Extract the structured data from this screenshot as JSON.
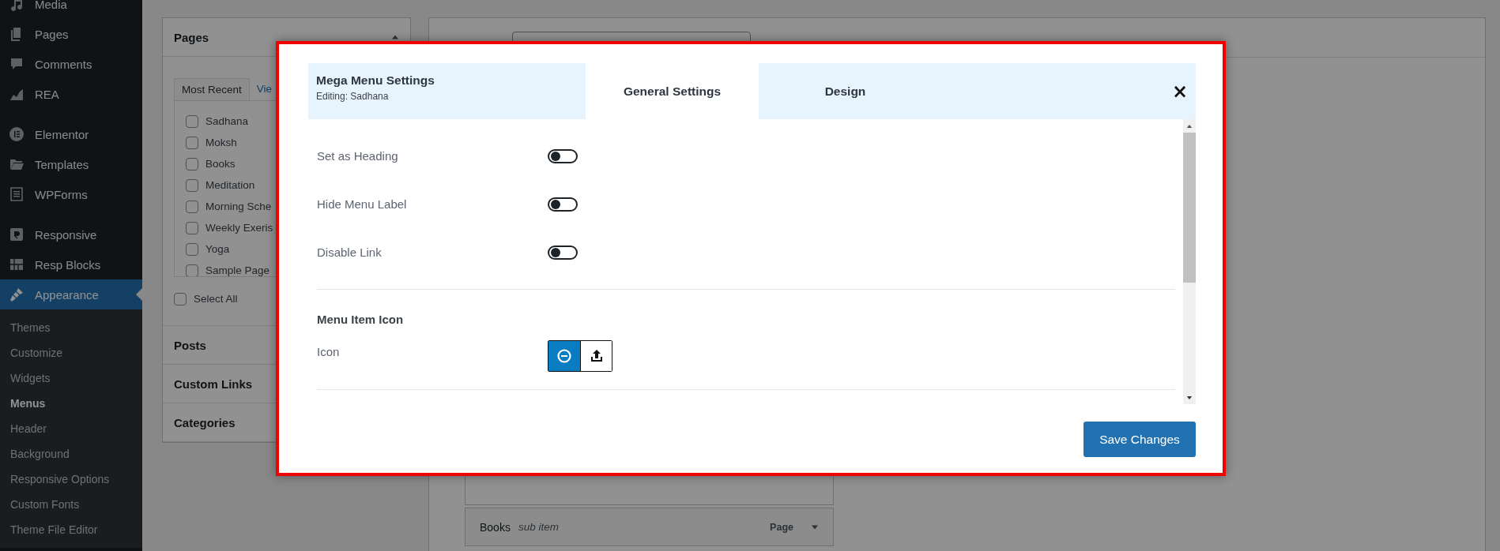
{
  "sidebar": {
    "menu": [
      [
        {
          "label": "Media",
          "current": false
        },
        {
          "label": "Pages",
          "current": false
        },
        {
          "label": "Comments",
          "current": false
        },
        {
          "label": "REA",
          "current": false
        }
      ],
      [
        {
          "label": "Elementor",
          "current": false
        },
        {
          "label": "Templates",
          "current": false
        },
        {
          "label": "WPForms",
          "current": false
        }
      ],
      [
        {
          "label": "Responsive",
          "current": false
        },
        {
          "label": "Resp Blocks",
          "current": false
        },
        {
          "label": "Appearance",
          "current": true
        }
      ]
    ],
    "submenu": [
      {
        "label": "Themes",
        "selected": false
      },
      {
        "label": "Customize",
        "selected": false
      },
      {
        "label": "Widgets",
        "selected": false
      },
      {
        "label": "Menus",
        "selected": true
      },
      {
        "label": "Header",
        "selected": false
      },
      {
        "label": "Background",
        "selected": false
      },
      {
        "label": "Responsive Options",
        "selected": false
      },
      {
        "label": "Custom Fonts",
        "selected": false
      },
      {
        "label": "Theme File Editor",
        "selected": false
      }
    ]
  },
  "add_items": {
    "pages": {
      "title": "Pages",
      "expanded": true,
      "tabs": [
        {
          "label": "Most Recent",
          "selected": true
        },
        {
          "label": "Vie",
          "selected": false
        }
      ],
      "items": [
        {
          "label": "Sadhana",
          "checked": false
        },
        {
          "label": "Moksh",
          "checked": false
        },
        {
          "label": "Books",
          "checked": false
        },
        {
          "label": "Meditation",
          "checked": false
        },
        {
          "label": "Morning Sche",
          "checked": false
        },
        {
          "label": "Weekly Exeris",
          "checked": false
        },
        {
          "label": "Yoga",
          "checked": false
        },
        {
          "label": "Sample Page",
          "checked": false
        }
      ],
      "select_all": {
        "label": "Select All",
        "checked": false
      }
    },
    "sections": [
      "Posts",
      "Custom Links",
      "Categories"
    ]
  },
  "menu_structure": {
    "items": [
      {
        "title": "Books",
        "subtitle": "sub item",
        "type": "Page"
      }
    ]
  },
  "modal": {
    "title": "Mega Menu Settings",
    "subtitle": "Editing: Sadhana",
    "tabs": [
      {
        "label": "General Settings",
        "selected": true
      },
      {
        "label": "Design",
        "selected": false
      }
    ],
    "close": "×",
    "settings": [
      {
        "label": "Set as Heading",
        "on": false
      },
      {
        "label": "Hide Menu Label",
        "on": false
      },
      {
        "label": "Disable Link",
        "on": false
      }
    ],
    "icon_section": {
      "heading": "Menu Item Icon",
      "label": "Icon",
      "options": [
        {
          "kind": "none",
          "selected": true
        },
        {
          "kind": "upload",
          "selected": false
        }
      ]
    },
    "save": "Save Changes"
  }
}
